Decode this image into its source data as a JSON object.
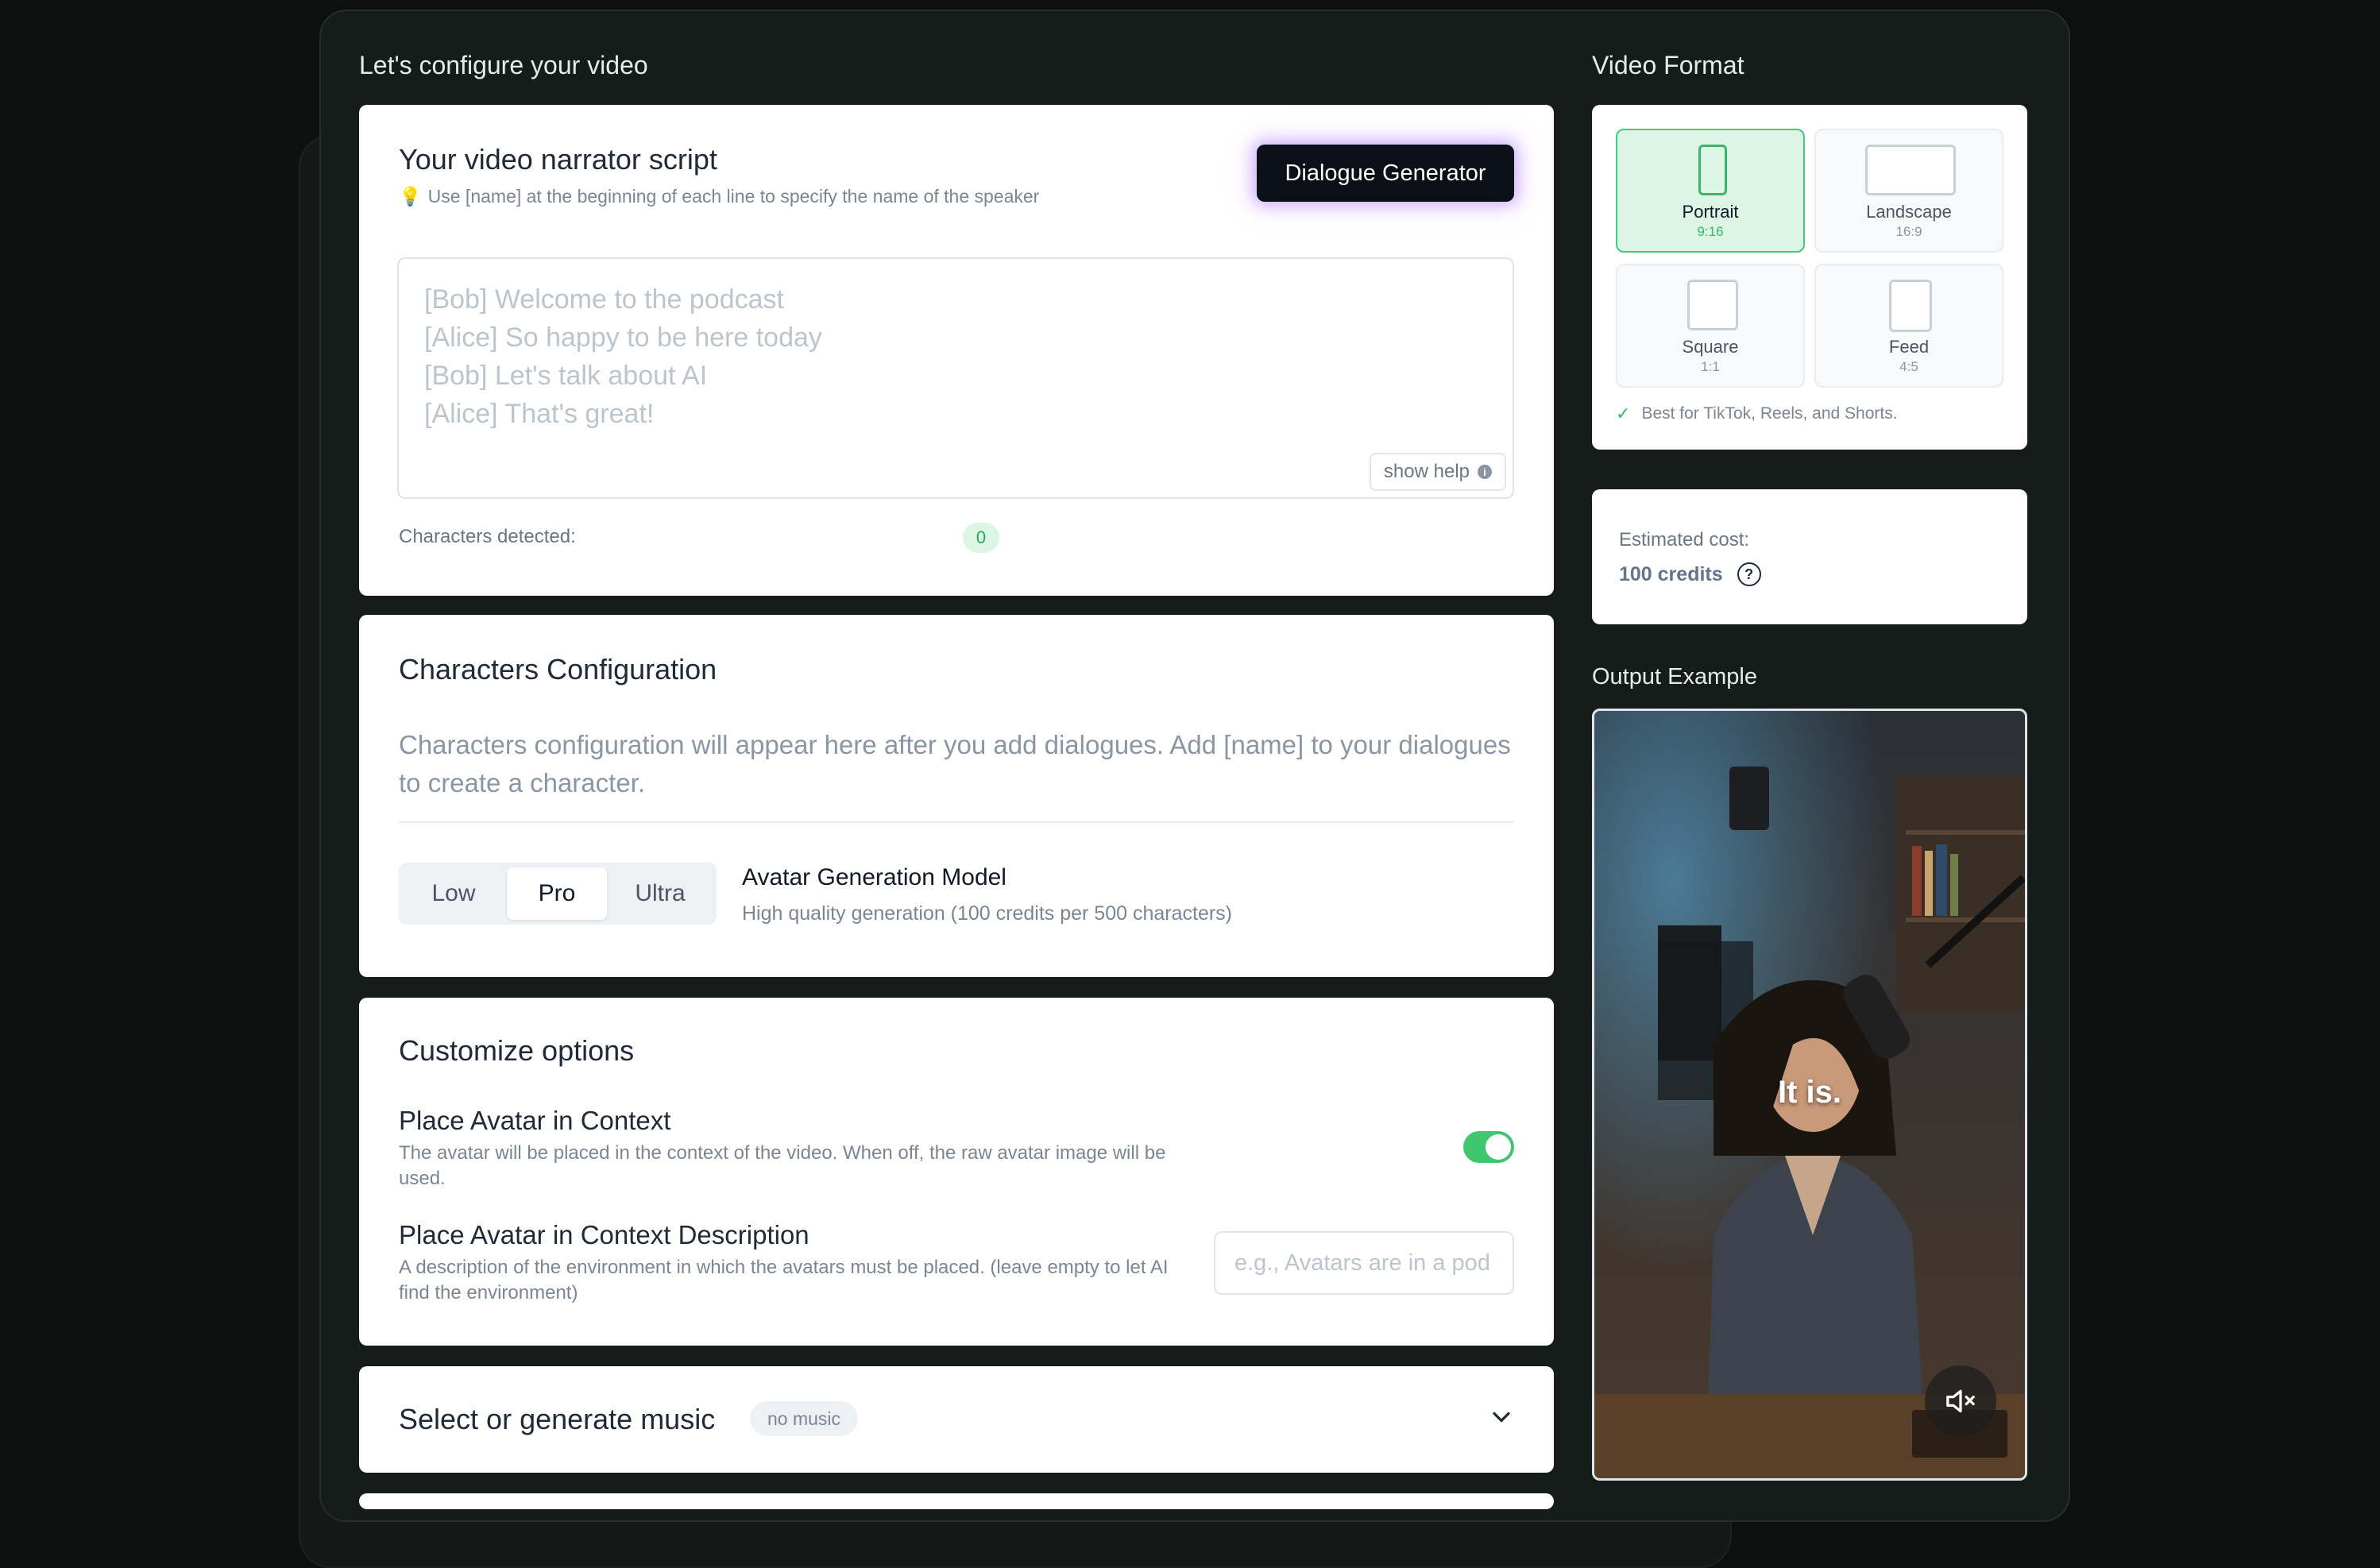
{
  "page": {
    "config_title": "Let's configure your video",
    "format_title": "Video Format",
    "output_title": "Output Example"
  },
  "script": {
    "title": "Your video narrator script",
    "hint": "Use [name] at the beginning of each line to specify the name of the speaker",
    "hint_icon": "lightbulb-icon",
    "dialogue_button": "Dialogue Generator",
    "placeholder_lines": [
      "[Bob] Welcome to the podcast",
      "[Alice] So happy to be here today",
      "[Bob] Let's talk about AI",
      "[Alice] That's great!"
    ],
    "show_help": "show help",
    "characters_label": "Characters detected:",
    "characters_count": "0"
  },
  "characters": {
    "title": "Characters Configuration",
    "description": "Characters configuration will appear here after you add dialogues. Add [name] to your dialogues to create a character.",
    "quality_options": [
      "Low",
      "Pro",
      "Ultra"
    ],
    "quality_selected": "Pro",
    "model_title": "Avatar Generation Model",
    "model_subtitle": "High quality generation (100 credits per 500 characters)"
  },
  "customize": {
    "title": "Customize options",
    "context_title": "Place Avatar in Context",
    "context_desc": "The avatar will be placed in the context of the video. When off, the raw avatar image will be used.",
    "context_enabled": true,
    "context_desc_title": "Place Avatar in Context Description",
    "context_desc_text": "A description of the environment in which the avatars must be placed. (leave empty to let AI find the environment)",
    "context_desc_placeholder": "e.g., Avatars are in a pod"
  },
  "music": {
    "title": "Select or generate music",
    "badge": "no music"
  },
  "format": {
    "options": [
      {
        "name": "Portrait",
        "ratio": "9:16",
        "selected": true
      },
      {
        "name": "Landscape",
        "ratio": "16:9",
        "selected": false
      },
      {
        "name": "Square",
        "ratio": "1:1",
        "selected": false
      },
      {
        "name": "Feed",
        "ratio": "4:5",
        "selected": false
      }
    ],
    "note": "Best for TikTok, Reels, and Shorts."
  },
  "cost": {
    "label": "Estimated cost:",
    "value": "100 credits"
  },
  "output": {
    "caption": "It is.",
    "mute_icon": "volume-mute-icon"
  },
  "colors": {
    "accent_green": "#3fc66f",
    "dark_bg": "#161c1a",
    "button_dark": "#0b0f17"
  }
}
